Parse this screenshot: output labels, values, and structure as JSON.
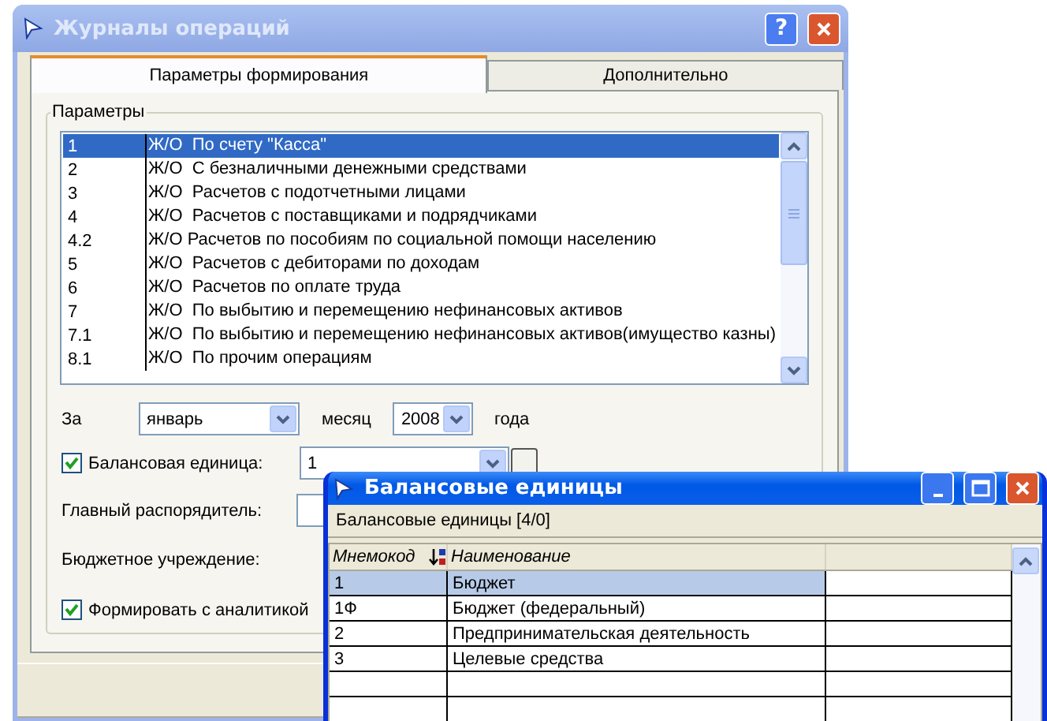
{
  "main_window": {
    "title": "Журналы операций",
    "help_button": "?",
    "tabs": [
      {
        "label": "Параметры формирования",
        "selected": true
      },
      {
        "label": "Дополнительно",
        "selected": false
      }
    ],
    "group_title": "Параметры",
    "journal_list": [
      {
        "code": "1",
        "name": "Ж/О  По счету \"Касса\"",
        "selected": true
      },
      {
        "code": "2",
        "name": "Ж/О  С безналичными денежными средствами",
        "selected": false
      },
      {
        "code": "3",
        "name": "Ж/О  Расчетов с подотчетными лицами",
        "selected": false
      },
      {
        "code": "4",
        "name": "Ж/О  Расчетов с поставщиками и подрядчиками",
        "selected": false
      },
      {
        "code": "4.2",
        "name": "Ж/О Расчетов по пособиям по социальной помощи населению",
        "selected": false
      },
      {
        "code": "5",
        "name": "Ж/О  Расчетов с дебиторами по доходам",
        "selected": false
      },
      {
        "code": "6",
        "name": "Ж/О  Расчетов по оплате труда",
        "selected": false
      },
      {
        "code": "7",
        "name": "Ж/О  По выбытию и перемещению нефинансовых активов",
        "selected": false
      },
      {
        "code": "7.1",
        "name": "Ж/О  По выбытию и перемещению нефинансовых активов(имущество казны)",
        "selected": false
      },
      {
        "code": "8.1",
        "name": "Ж/О  По прочим операциям",
        "selected": false
      }
    ],
    "period": {
      "label": "За",
      "month": "январь",
      "month_label": "месяц",
      "year": "2008",
      "year_label": "года"
    },
    "balance_unit": {
      "label": "Балансовая единица:",
      "checked": true,
      "value": "1"
    },
    "main_manager": {
      "label": "Главный распорядитель:"
    },
    "budget_institution": {
      "label": "Бюджетное учреждение:"
    },
    "with_analytics": {
      "label": "Формировать с аналитикой",
      "checked": true
    }
  },
  "lookup_window": {
    "title": "Балансовые единицы",
    "caption": "Балансовые единицы [4/0]",
    "columns": [
      "Мнемокод",
      "Наименование"
    ],
    "rows": [
      {
        "code": "1",
        "name": "Бюджет",
        "selected": true
      },
      {
        "code": "1Ф",
        "name": "Бюджет (федеральный)",
        "selected": false
      },
      {
        "code": "2",
        "name": "Предпринимательская деятельность",
        "selected": false
      },
      {
        "code": "3",
        "name": "Целевые средства",
        "selected": false
      }
    ]
  }
}
